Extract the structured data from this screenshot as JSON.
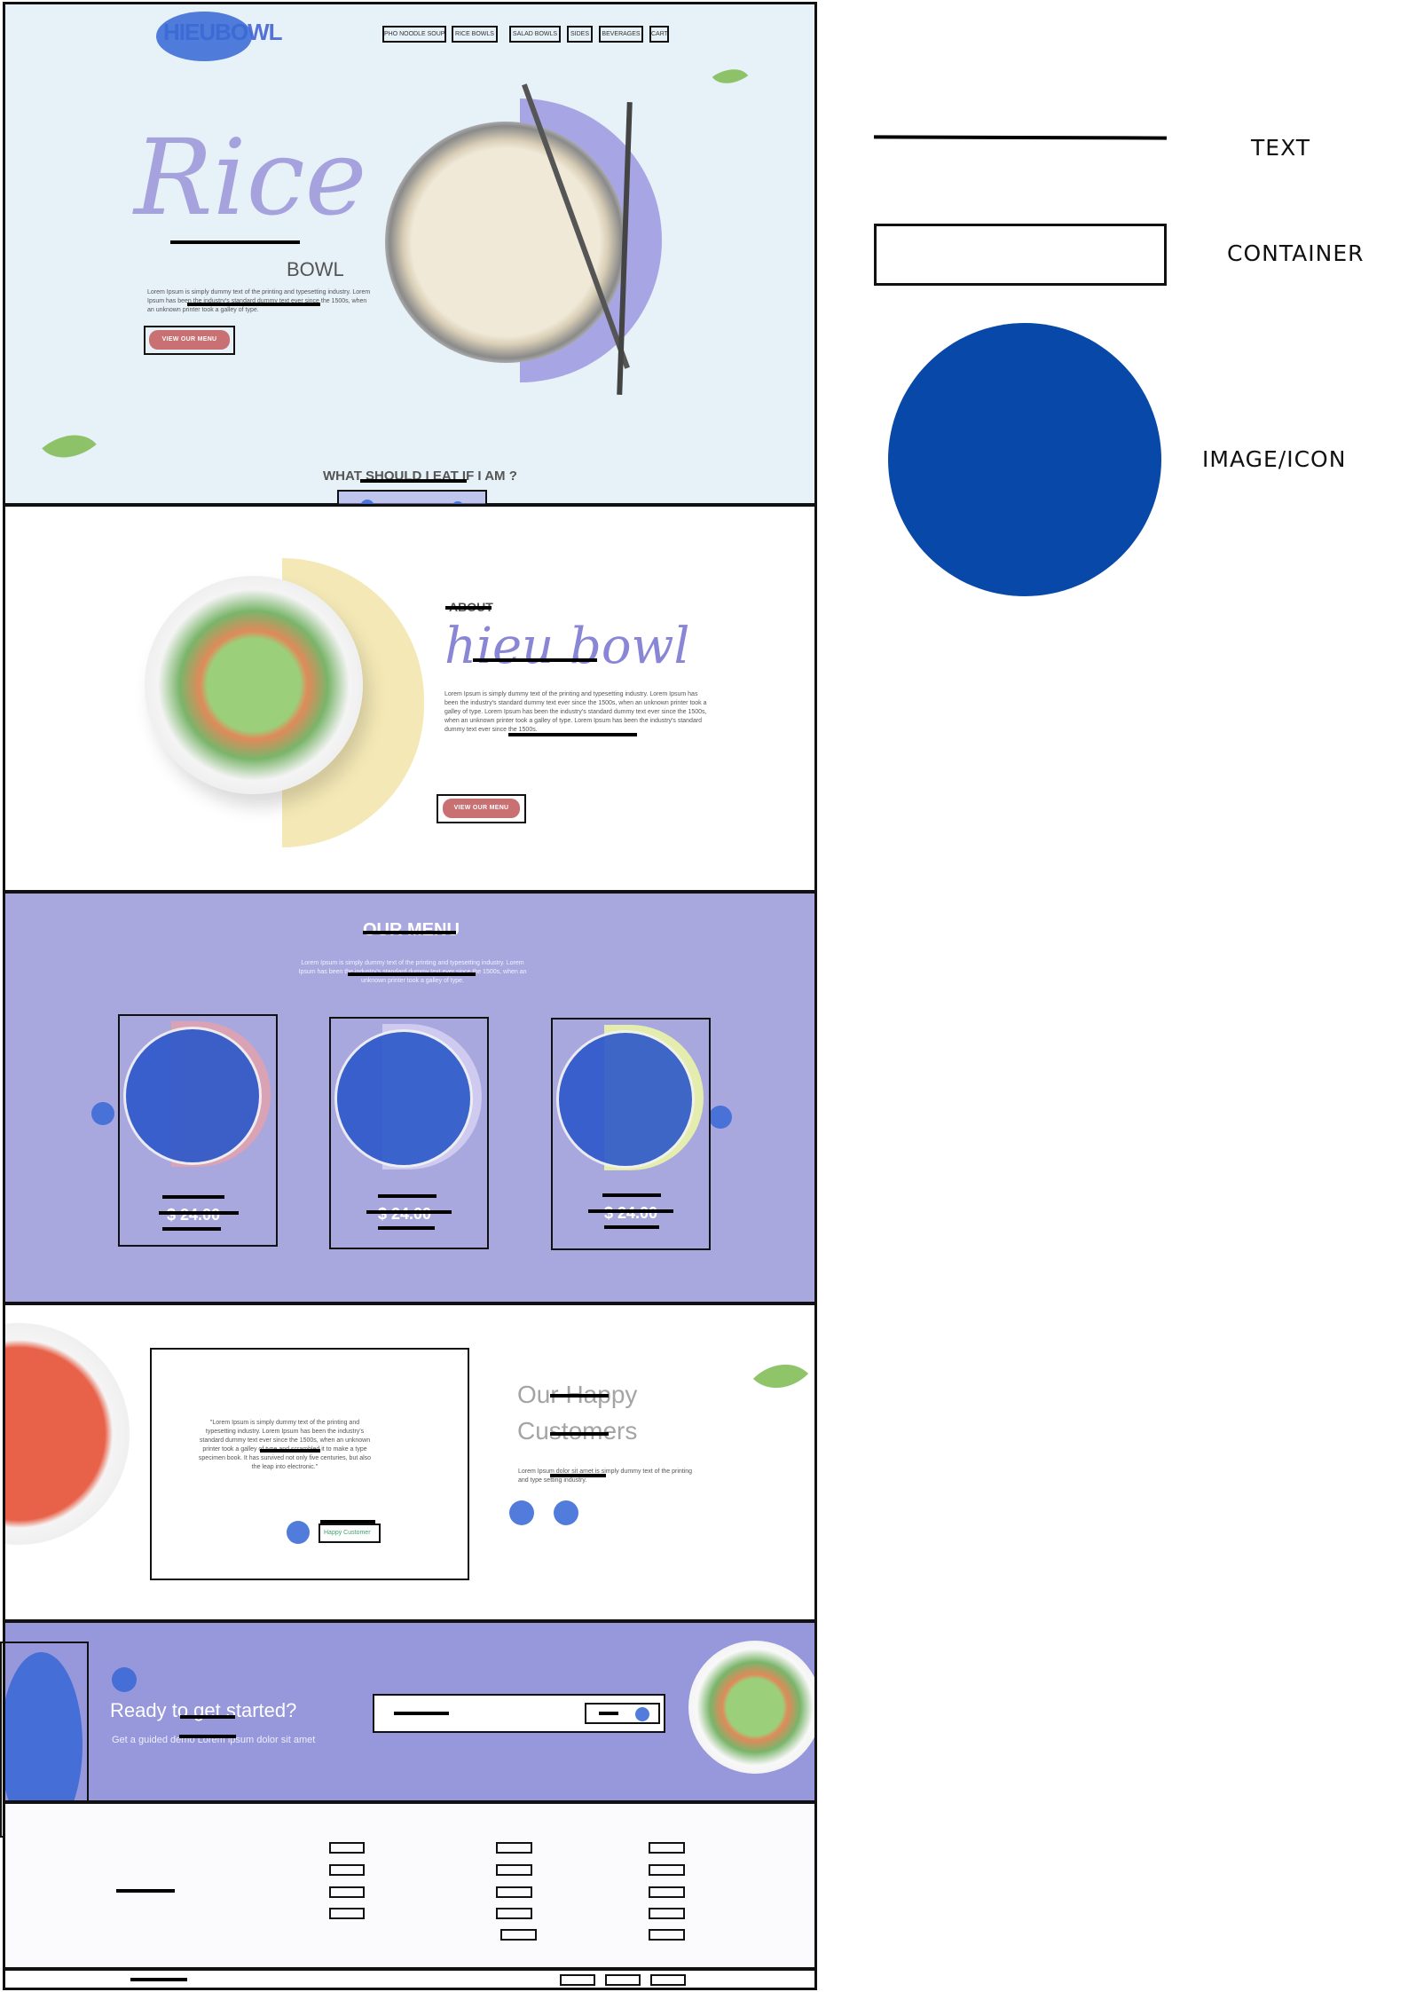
{
  "brand": {
    "logo_text": "HIEUBOWL"
  },
  "nav": {
    "items": [
      "PHO NOODLE SOUP",
      "RICE BOWLS",
      "SALAD BOWLS",
      "SIDES",
      "BEVERAGES",
      "CART"
    ]
  },
  "hero": {
    "title": "Rice",
    "subtitle": "BOWL",
    "body": "Lorem Ipsum is simply dummy text of the printing and typesetting industry. Lorem Ipsum has been the industry's standard dummy text ever since the 1500s, when an unknown printer took a galley of type.",
    "cta_label": "VIEW OUR MENU",
    "question": "WHAT SHOULD I EAT IF I AM ?"
  },
  "about": {
    "eyebrow": "ABOUT",
    "title": "hieu bowl",
    "body": "Lorem Ipsum is simply dummy text of the printing and typesetting industry. Lorem Ipsum has been the industry's standard dummy text ever since the 1500s, when an unknown printer took a galley of type. Lorem Ipsum has been the industry's standard dummy text ever since the 1500s, when an unknown printer took a galley of type. Lorem Ipsum has been the industry's standard dummy text ever since the 1500s.",
    "cta_label": "VIEW OUR MENU"
  },
  "menu": {
    "title": "OUR MENU",
    "intro": "Lorem Ipsum is simply dummy text of the printing and typesetting industry. Lorem Ipsum has been the industry's standard dummy text ever since the 1500s, when an unknown printer took a galley of type.",
    "cards": [
      {
        "price": "$ 24.00"
      },
      {
        "price": "$ 24.00"
      },
      {
        "price": "$ 24.00"
      }
    ]
  },
  "testimonials": {
    "heading_line1": "Our Happy",
    "heading_line2": "Customers",
    "subtext": "Lorem Ipsum dolor sit amet is simply dummy text of the printing and type setting industry.",
    "quote": "\"Lorem Ipsum is simply dummy text of the printing and typesetting industry. Lorem Ipsum has been the industry's standard dummy text ever since the 1500s, when an unknown printer took a galley of type and scrambled it to make a type specimen book. It has survived not only five centuries, but also the leap into electronic.\"",
    "author_title": "Happy Customer"
  },
  "cta": {
    "heading": "Ready to get started?",
    "subtext": "Get a guided demo Lorem ipsum dolor sit amet"
  },
  "legend": {
    "text": "TEXT",
    "container": "CONTAINER",
    "image_icon": "IMAGE/ICON"
  },
  "colors": {
    "hero_bg": "#e6f1f8",
    "menu_bg": "#a8a8df",
    "cta_bg": "#9797dc",
    "accent_button": "#c87072",
    "annotation_blue": "#3a6ad6",
    "legend_blue": "#0748a8"
  }
}
